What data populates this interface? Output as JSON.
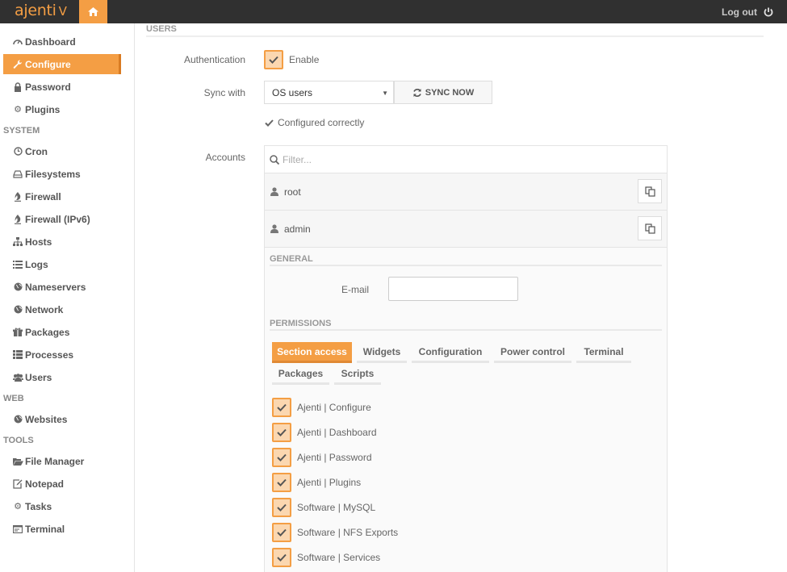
{
  "brand": {
    "name": "ajenti",
    "version": "V"
  },
  "header": {
    "logout_label": "Log out"
  },
  "sidebar": {
    "top_items": [
      {
        "label": "Dashboard",
        "icon": "dashboard-icon"
      },
      {
        "label": "Configure",
        "icon": "wrench-icon",
        "active": true
      },
      {
        "label": "Password",
        "icon": "lock-icon"
      },
      {
        "label": "Plugins",
        "icon": "cogs-icon"
      }
    ],
    "sections": [
      {
        "title": "SYSTEM",
        "items": [
          "Cron",
          "Filesystems",
          "Firewall",
          "Firewall (IPv6)",
          "Hosts",
          "Logs",
          "Nameservers",
          "Network",
          "Packages",
          "Processes",
          "Users"
        ]
      },
      {
        "title": "WEB",
        "items": [
          "Websites"
        ]
      },
      {
        "title": "TOOLS",
        "items": [
          "File Manager",
          "Notepad",
          "Tasks",
          "Terminal"
        ]
      }
    ]
  },
  "users": {
    "section_title": "USERS",
    "auth_label": "Authentication",
    "enable_label": "Enable",
    "sync_label": "Sync with",
    "sync_value": "OS users",
    "sync_button": "SYNC NOW",
    "status": "Configured correctly",
    "accounts_label": "Accounts",
    "filter_placeholder": "Filter...",
    "accounts": [
      "root",
      "admin"
    ]
  },
  "account_detail": {
    "general_title": "GENERAL",
    "email_label": "E-mail",
    "email_value": "",
    "permissions_title": "PERMISSIONS",
    "tabs": [
      "Section access",
      "Widgets",
      "Configuration",
      "Power control",
      "Terminal",
      "Packages",
      "Scripts"
    ],
    "active_tab": "Section access",
    "permissions": [
      "Ajenti | Configure",
      "Ajenti | Dashboard",
      "Ajenti | Password",
      "Ajenti | Plugins",
      "Software | MySQL",
      "Software | NFS Exports",
      "Software | Services"
    ]
  },
  "colors": {
    "accent": "#f49e44",
    "topbar": "#303030"
  }
}
